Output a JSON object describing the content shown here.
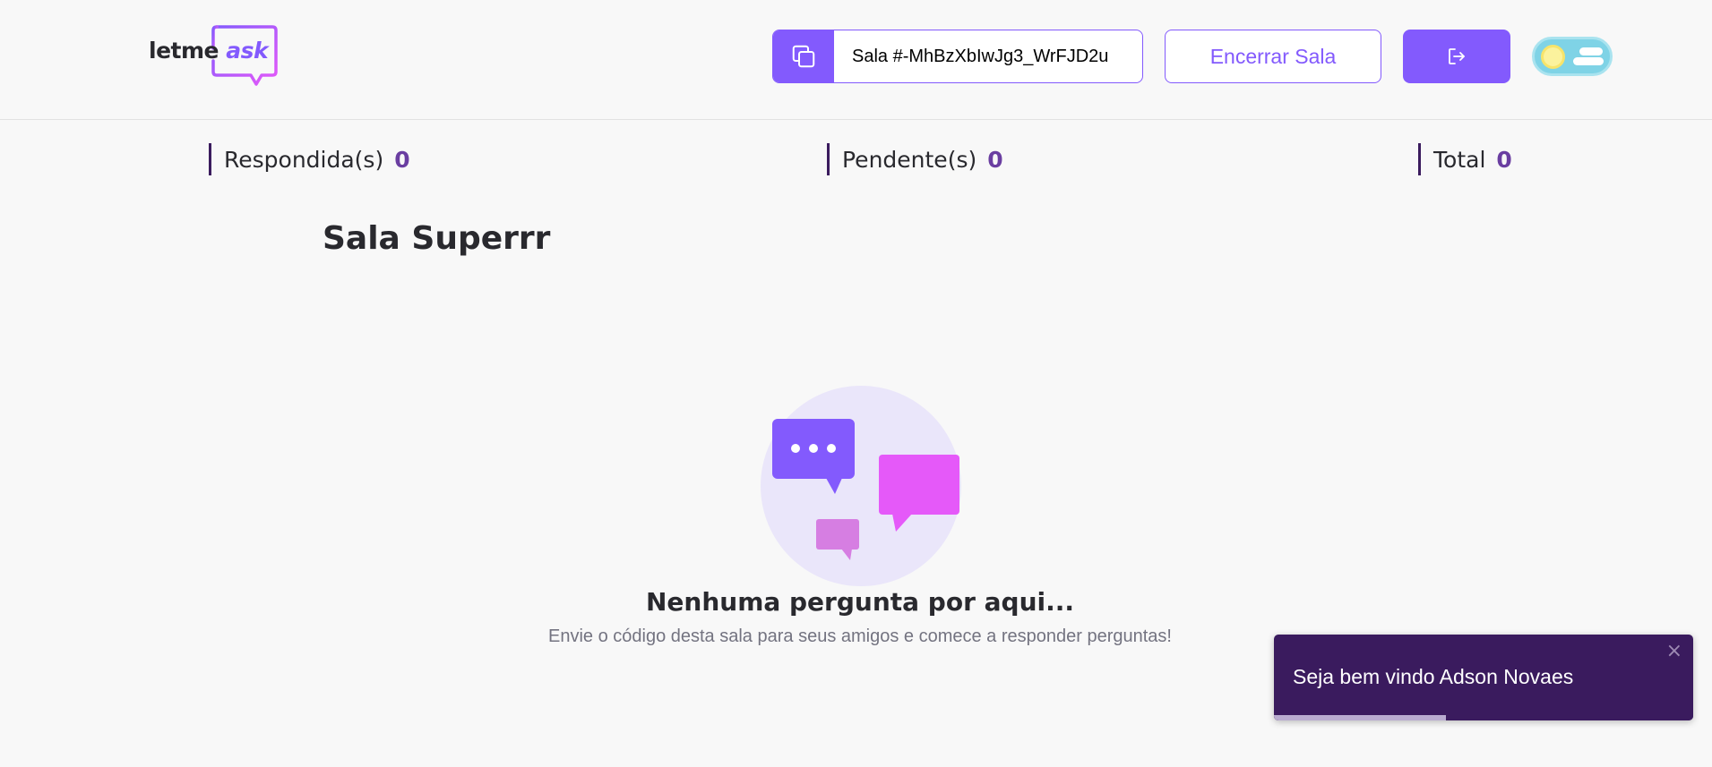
{
  "header": {
    "logo": {
      "part1": "letme",
      "part2": "ask"
    },
    "room_code": {
      "text": "Sala #-MhBzXbIwJg3_WrFJD2u",
      "icon": "copy-icon"
    },
    "close_room_label": "Encerrar Sala",
    "logout_icon": "logout-icon",
    "theme_toggle": {
      "icon": "sun-icon",
      "state": "light"
    }
  },
  "counters": {
    "answered": {
      "label": "Respondida(s)",
      "value": "0"
    },
    "pending": {
      "label": "Pendente(s)",
      "value": "0"
    },
    "total": {
      "label": "Total",
      "value": "0"
    }
  },
  "room": {
    "title": "Sala Superrr"
  },
  "empty_state": {
    "illustration": "empty-questions-illustration",
    "title": "Nenhuma pergunta por aqui...",
    "subtitle": "Envie o código desta sala para seus amigos e comece a responder perguntas!"
  },
  "toast": {
    "message": "Seja bem vindo Adson Novaes",
    "close_symbol": "×",
    "progress": 0.41
  },
  "colors": {
    "accent": "#835afd",
    "toast_bg": "#3a1b5e",
    "counter_value": "#6a3ea1",
    "pink": "#e559f9"
  }
}
